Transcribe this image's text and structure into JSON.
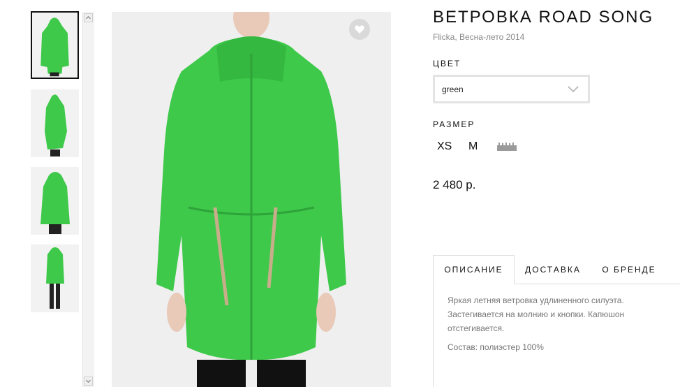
{
  "product": {
    "title": "ВЕТРОВКА ROAD SONG",
    "subtitle": "Flicka, Весна-лето 2014",
    "color_label": "ЦВЕТ",
    "color_value": "green",
    "size_label": "РАЗМЕР",
    "sizes": [
      "XS",
      "M"
    ],
    "price": "2 480 р."
  },
  "tabs": [
    "ОПИСАНИЕ",
    "ДОСТАВКА",
    "О БРЕНДЕ"
  ],
  "description": {
    "text": "Яркая летняя ветровка удлиненного силуэта. Застегивается на молнию и кнопки. Капюшон отстегивается.",
    "composition": "Состав: полиэстер 100%"
  },
  "colors": {
    "jacket": "#3ec94a",
    "accent": "#111111"
  },
  "icons": [
    "heart-icon",
    "chevron-down-icon",
    "ruler-icon",
    "scroll-up-icon",
    "scroll-down-icon"
  ]
}
